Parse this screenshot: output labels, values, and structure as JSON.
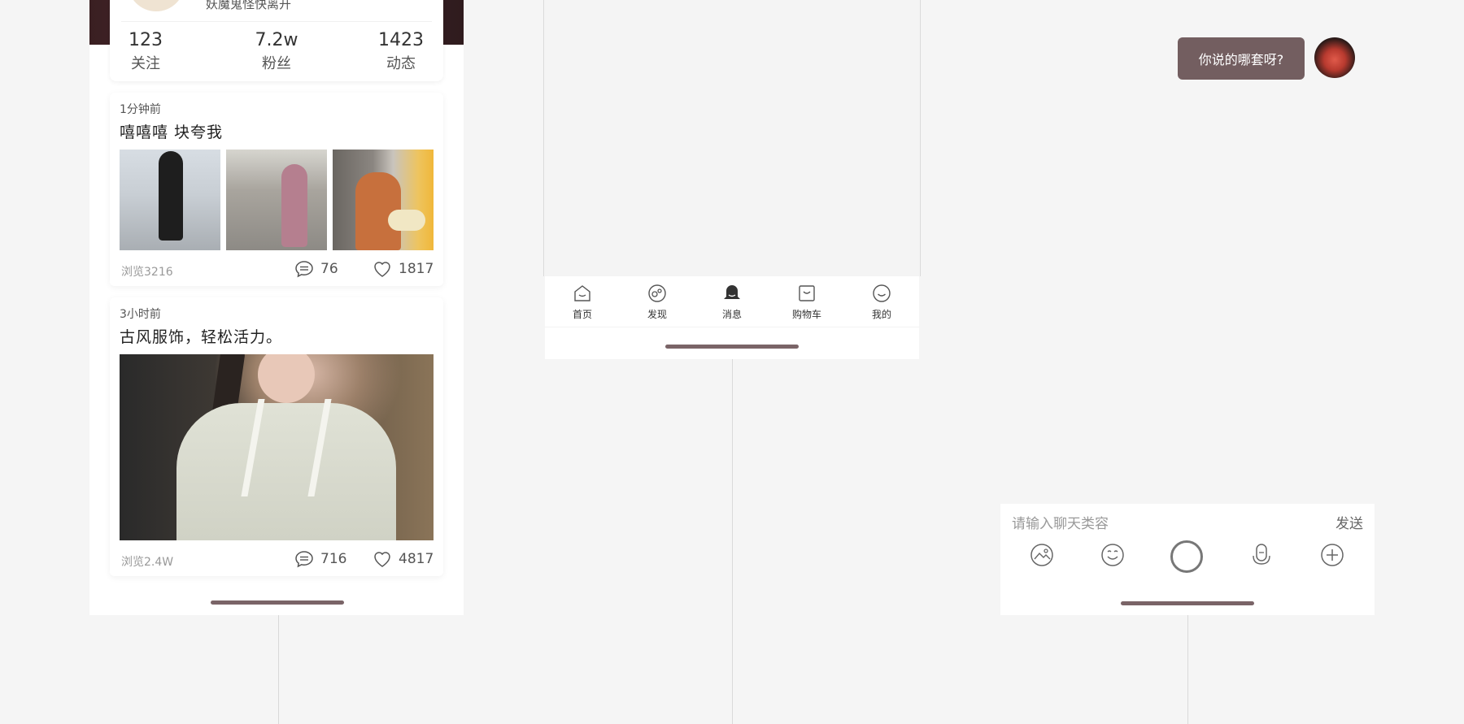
{
  "profile": {
    "bio": "妖魔鬼怪快离开",
    "stats": [
      {
        "num": "123",
        "label": "关注"
      },
      {
        "num": "7.2w",
        "label": "粉丝"
      },
      {
        "num": "1423",
        "label": "动态"
      }
    ]
  },
  "posts": [
    {
      "time": "1分钟前",
      "text": "嘻嘻嘻 块夸我",
      "views": "浏览3216",
      "comments": "76",
      "likes": "1817"
    },
    {
      "time": "3小时前",
      "text": "古风服饰，轻松活力。",
      "views": "浏览2.4W",
      "comments": "716",
      "likes": "4817"
    }
  ],
  "tabbar": {
    "tabs": [
      {
        "label": "首页",
        "icon": "home-icon"
      },
      {
        "label": "发现",
        "icon": "discover-icon"
      },
      {
        "label": "消息",
        "icon": "message-icon",
        "active": true
      },
      {
        "label": "购物车",
        "icon": "cart-icon"
      },
      {
        "label": "我的",
        "icon": "profile-icon"
      }
    ]
  },
  "chat": {
    "message": "你说的哪套呀?",
    "input_placeholder": "请输入聊天类容",
    "send_label": "发送",
    "tools": [
      "image-icon",
      "emoji-icon",
      "record-icon",
      "mic-icon",
      "plus-icon"
    ]
  },
  "colors": {
    "accent": "#735e60",
    "home_indicator": "#7a6467",
    "background": "#f5f5f5"
  }
}
